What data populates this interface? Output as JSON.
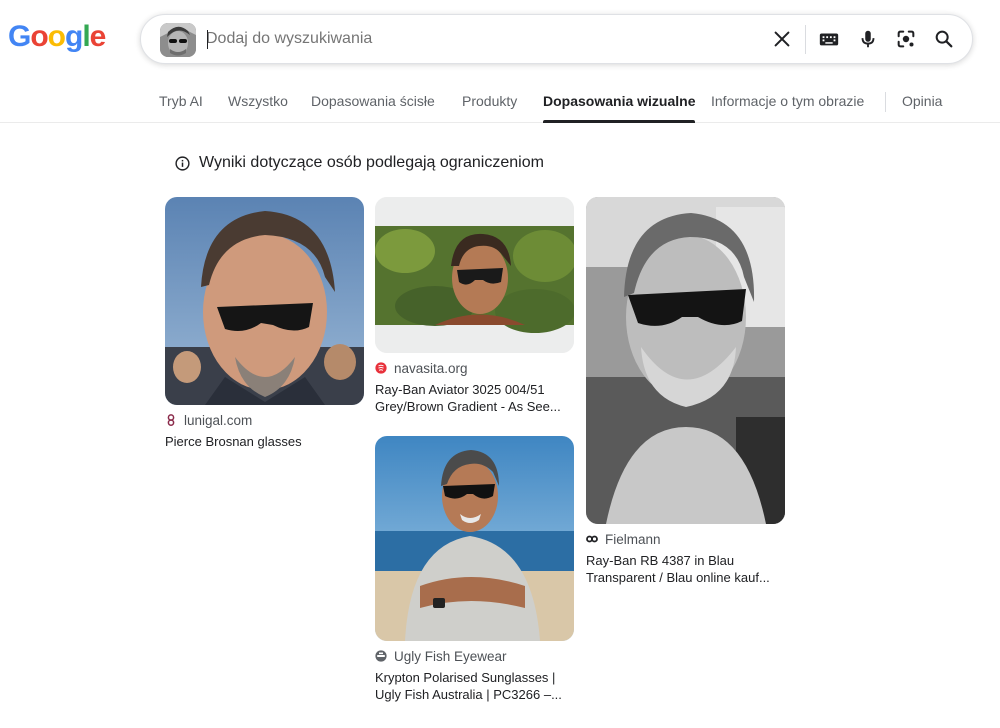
{
  "logo": {
    "letters": [
      "G",
      "o",
      "o",
      "g",
      "l",
      "e"
    ],
    "colors": [
      "#4285f4",
      "#ea4335",
      "#fbbc05",
      "#4285f4",
      "#34a853",
      "#ea4335"
    ]
  },
  "search": {
    "placeholder": "Dodaj do wyszukiwania",
    "icons": [
      "clear-icon",
      "keyboard-icon",
      "microphone-icon",
      "lens-icon",
      "search-icon"
    ]
  },
  "tabs": [
    {
      "label": "Tryb AI",
      "active": false
    },
    {
      "label": "Wszystko",
      "active": false
    },
    {
      "label": "Dopasowania ścisłe",
      "active": false
    },
    {
      "label": "Produkty",
      "active": false
    },
    {
      "label": "Dopasowania wizualne",
      "active": true
    },
    {
      "label": "Informacje o tym obrazie",
      "active": false
    },
    {
      "label": "Opinia",
      "active": false
    }
  ],
  "notice": {
    "text": "Wyniki dotyczące osób podlegają ograniczeniom",
    "icon": "info-icon"
  },
  "results": [
    {
      "source": "lunigal.com",
      "favicon_color": "#8b2b4b",
      "title_lines": [
        "Pierce Brosnan glasses"
      ]
    },
    {
      "source": "navasita.org",
      "favicon_color": "#e8313b",
      "title_lines": [
        "Ray-Ban Aviator 3025 004/51",
        "Grey/Brown Gradient - As See..."
      ]
    },
    {
      "source": "Fielmann",
      "favicon_color": "#202124",
      "title_lines": [
        "Ray-Ban RB 4387 in Blau",
        "Transparent / Blau online kauf..."
      ]
    },
    {
      "source": "Ugly Fish Eyewear",
      "favicon_color": "#5f6368",
      "title_lines": [
        "Krypton Polarised Sunglasses |",
        "Ugly Fish Australia | PC3266 –..."
      ]
    }
  ],
  "colors": {
    "text_primary": "#202124",
    "text_secondary": "#5f6368",
    "border": "#dfe1e5"
  }
}
